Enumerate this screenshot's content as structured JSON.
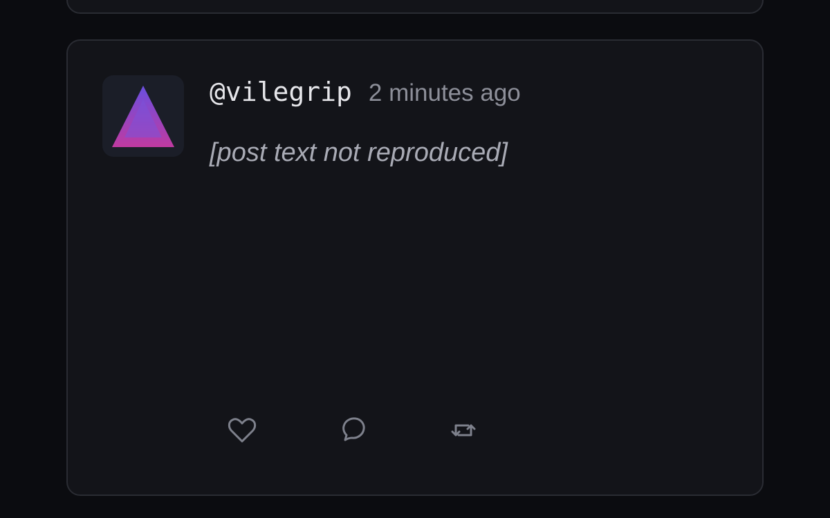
{
  "post": {
    "handle": "@vilegrip",
    "timestamp": "2 minutes ago",
    "body_placeholder": "[post text not reproduced]"
  },
  "icons": {
    "avatar": "purple-triangle-logo",
    "like": "heart-icon",
    "reply": "speech-bubble-icon",
    "repost": "repost-arrows-icon"
  },
  "colors": {
    "background": "#0b0c10",
    "card": "#131419",
    "card_border": "#2a2c33",
    "avatar_bg": "#1b1e28",
    "text": "#e6e6ea",
    "muted": "#8d8f99",
    "icon": "#7e818c",
    "triangle_top": "#6a4fe0",
    "triangle_bottom": "#c03aa0"
  }
}
